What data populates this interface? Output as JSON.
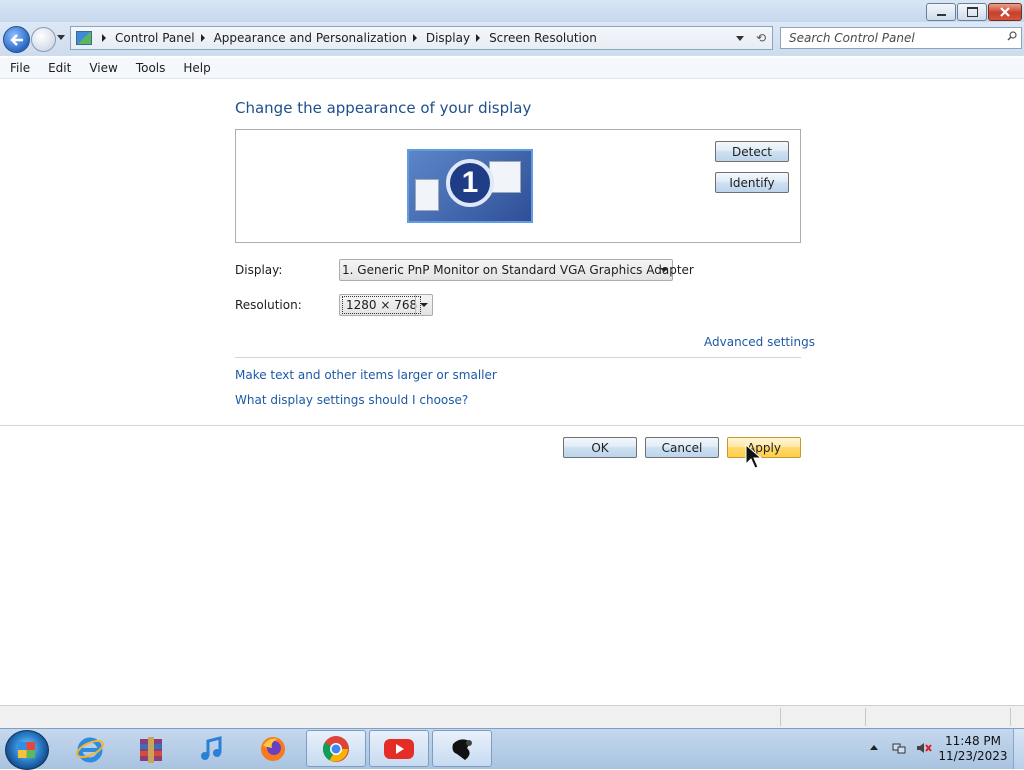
{
  "breadcrumbs": [
    "Control Panel",
    "Appearance and Personalization",
    "Display",
    "Screen Resolution"
  ],
  "search": {
    "placeholder": "Search Control Panel"
  },
  "menu": [
    "File",
    "Edit",
    "View",
    "Tools",
    "Help"
  ],
  "main": {
    "title": "Change the appearance of your display",
    "monitor_number": "1",
    "detect_label": "Detect",
    "identify_label": "Identify",
    "display_label": "Display:",
    "display_value": "1. Generic PnP Monitor on Standard VGA Graphics Adapter",
    "resolution_label": "Resolution:",
    "resolution_value": "1280 × 768",
    "advanced_link": "Advanced settings",
    "larger_link": "Make text and other items larger or smaller",
    "choose_link": "What display settings should I choose?"
  },
  "buttons": {
    "ok": "OK",
    "cancel": "Cancel",
    "apply": "Apply"
  },
  "taskbar": {
    "items": [
      "start-orb",
      "internet-explorer",
      "winrar",
      "itunes",
      "firefox",
      "chrome",
      "youtube",
      "screen-resolution"
    ],
    "clock_time": "11:48 PM",
    "clock_date": "11/23/2023"
  },
  "colors": {
    "link": "#1c5aa6",
    "title": "#1e4f8e",
    "apply_highlight": "#ffd96b"
  }
}
